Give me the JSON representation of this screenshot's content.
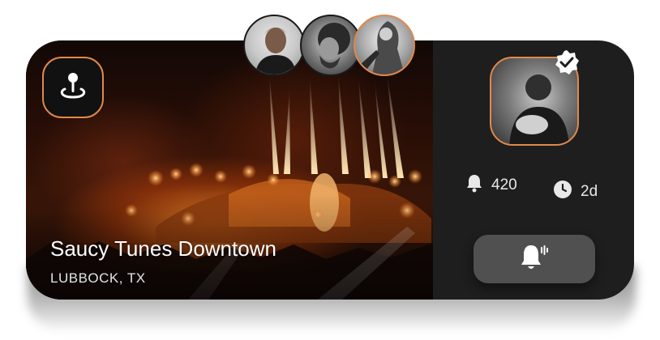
{
  "event": {
    "title": "Saucy Tunes Downtown",
    "location": "LUBBOCK, TX"
  },
  "stats": {
    "notifications": "420",
    "time": "2d"
  },
  "icons": {
    "pin": "location-pin-icon",
    "verified": "verified-badge-icon",
    "bell": "bell-icon",
    "clock": "clock-icon",
    "notify": "bell-ringing-icon"
  },
  "colors": {
    "accent": "#e0894c",
    "card": "#1e1e1e",
    "button": "#505050"
  },
  "attendees": [
    {
      "name": "attendee-1"
    },
    {
      "name": "attendee-2"
    },
    {
      "name": "attendee-3"
    }
  ]
}
